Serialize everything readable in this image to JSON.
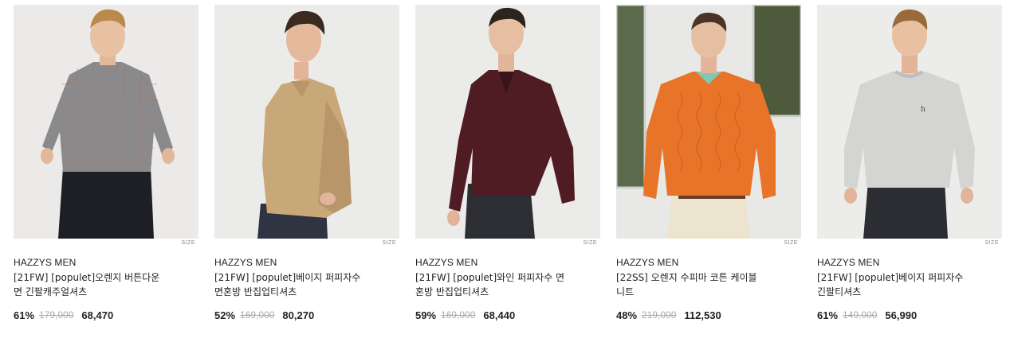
{
  "products": [
    {
      "brand": "HAZZYS MEN",
      "name_line1": "[21FW] [populet]오렌지 버튼다운",
      "name_line2": "면 긴팔캐주얼셔츠",
      "discount": "61%",
      "original_price": "179,000",
      "sale_price": "68,470",
      "size_tag": "SIZE",
      "garment_color": "#8a8a8c",
      "image_desc": "gray check button-down shirt"
    },
    {
      "brand": "HAZZYS MEN",
      "name_line1": "[21FW] [populet]베이지 퍼피자수",
      "name_line2": "면혼방 반집업티셔츠",
      "discount": "52%",
      "original_price": "169,000",
      "sale_price": "80,270",
      "size_tag": "SIZE",
      "garment_color": "#c8a878",
      "image_desc": "beige half-zip pullover"
    },
    {
      "brand": "HAZZYS MEN",
      "name_line1": "[21FW] [populet]와인 퍼피자수 면",
      "name_line2": "혼방 반집업티셔츠",
      "discount": "59%",
      "original_price": "169,000",
      "sale_price": "68,440",
      "size_tag": "SIZE",
      "garment_color": "#4e1c22",
      "image_desc": "wine half-zip pullover"
    },
    {
      "brand": "HAZZYS MEN",
      "name_line1": "[22SS] 오렌지 수피마 코튼 케이블",
      "name_line2": "니트",
      "discount": "48%",
      "original_price": "219,000",
      "sale_price": "112,530",
      "size_tag": "SIZE",
      "garment_color": "#e8742a",
      "image_desc": "orange cable knit sweater"
    },
    {
      "brand": "HAZZYS MEN",
      "name_line1": "[21FW] [populet]베이지 퍼피자수",
      "name_line2": "긴팔티셔츠",
      "discount": "61%",
      "original_price": "149,000",
      "sale_price": "56,990",
      "size_tag": "SIZE",
      "garment_color": "#d4d4d2",
      "image_desc": "light gray crew neck sweatshirt"
    }
  ]
}
